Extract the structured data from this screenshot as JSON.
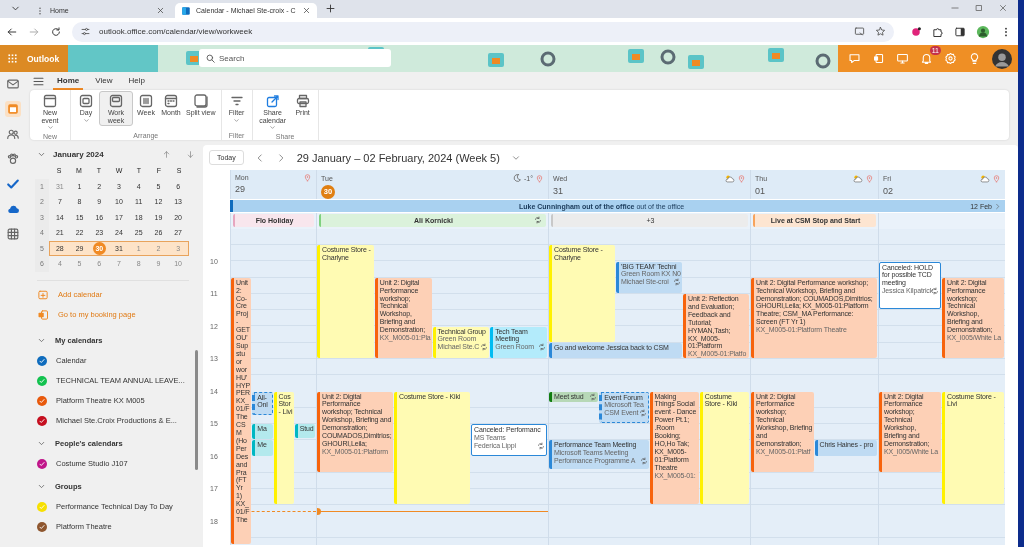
{
  "browser": {
    "tabs": [
      {
        "title": "Home",
        "selected": false
      },
      {
        "title": "Calendar - Michael Ste-croix - C",
        "selected": true
      }
    ],
    "url": "outlook.office.com/calendar/view/workweek"
  },
  "header": {
    "app_name": "Outlook",
    "search": {
      "placeholder": "Search"
    },
    "notification_count": "11"
  },
  "rail": [
    {
      "selected": false
    },
    {
      "selected": true
    },
    {
      "selected": false
    },
    {
      "selected": false
    },
    {
      "selected": false
    },
    {
      "selected": false
    },
    {
      "selected": false
    }
  ],
  "ribbon": {
    "tabs": [
      {
        "label": "Home",
        "selected": true
      },
      {
        "label": "View",
        "selected": false
      },
      {
        "label": "Help",
        "selected": false
      }
    ],
    "groups": [
      {
        "label": "New",
        "buttons": [
          {
            "label": "New event",
            "dropdown": true,
            "selected": false
          }
        ]
      },
      {
        "label": "Arrange",
        "buttons": [
          {
            "label": "Day",
            "dropdown": true,
            "selected": false
          },
          {
            "label": "Work week",
            "dropdown": false,
            "selected": true
          },
          {
            "label": "Week",
            "dropdown": false,
            "selected": false
          },
          {
            "label": "Month",
            "dropdown": false,
            "selected": false
          },
          {
            "label": "Split view",
            "dropdown": false,
            "selected": false
          }
        ]
      },
      {
        "label": "Filter",
        "buttons": [
          {
            "label": "Filter",
            "dropdown": true,
            "selected": false
          }
        ]
      },
      {
        "label": "Share",
        "buttons": [
          {
            "label": "Share calendar",
            "dropdown": true,
            "selected": false
          },
          {
            "label": "Print",
            "dropdown": false,
            "selected": false
          }
        ]
      }
    ]
  },
  "mini_calendar": {
    "title": "January 2024",
    "weekdays": [
      "S",
      "M",
      "T",
      "W",
      "T",
      "F",
      "S"
    ],
    "weeks": [
      {
        "number": "1",
        "selected": false,
        "days": [
          {
            "day": "31",
            "other_month": true,
            "today": false
          },
          {
            "day": "1",
            "other_month": false,
            "today": false
          },
          {
            "day": "2",
            "other_month": false,
            "today": false
          },
          {
            "day": "3",
            "other_month": false,
            "today": false
          },
          {
            "day": "4",
            "other_month": false,
            "today": false
          },
          {
            "day": "5",
            "other_month": false,
            "today": false
          },
          {
            "day": "6",
            "other_month": false,
            "today": false
          }
        ]
      },
      {
        "number": "2",
        "selected": false,
        "days": [
          {
            "day": "7",
            "other_month": false,
            "today": false
          },
          {
            "day": "8",
            "other_month": false,
            "today": false
          },
          {
            "day": "9",
            "other_month": false,
            "today": false
          },
          {
            "day": "10",
            "other_month": false,
            "today": false
          },
          {
            "day": "11",
            "other_month": false,
            "today": false
          },
          {
            "day": "12",
            "other_month": false,
            "today": false
          },
          {
            "day": "13",
            "other_month": false,
            "today": false
          }
        ]
      },
      {
        "number": "3",
        "selected": false,
        "days": [
          {
            "day": "14",
            "other_month": false,
            "today": false
          },
          {
            "day": "15",
            "other_month": false,
            "today": false
          },
          {
            "day": "16",
            "other_month": false,
            "today": false
          },
          {
            "day": "17",
            "other_month": false,
            "today": false
          },
          {
            "day": "18",
            "other_month": false,
            "today": false
          },
          {
            "day": "19",
            "other_month": false,
            "today": false
          },
          {
            "day": "20",
            "other_month": false,
            "today": false
          }
        ]
      },
      {
        "number": "4",
        "selected": false,
        "days": [
          {
            "day": "21",
            "other_month": false,
            "today": false
          },
          {
            "day": "22",
            "other_month": false,
            "today": false
          },
          {
            "day": "23",
            "other_month": false,
            "today": false
          },
          {
            "day": "24",
            "other_month": false,
            "today": false
          },
          {
            "day": "25",
            "other_month": false,
            "today": false
          },
          {
            "day": "26",
            "other_month": false,
            "today": false
          },
          {
            "day": "27",
            "other_month": false,
            "today": false
          }
        ]
      },
      {
        "number": "5",
        "selected": true,
        "days": [
          {
            "day": "28",
            "other_month": false,
            "today": false
          },
          {
            "day": "29",
            "other_month": false,
            "today": false
          },
          {
            "day": "30",
            "other_month": false,
            "today": true
          },
          {
            "day": "31",
            "other_month": false,
            "today": false
          },
          {
            "day": "1",
            "other_month": true,
            "today": false
          },
          {
            "day": "2",
            "other_month": true,
            "today": false
          },
          {
            "day": "3",
            "other_month": true,
            "today": false
          }
        ]
      },
      {
        "number": "6",
        "selected": false,
        "days": [
          {
            "day": "4",
            "other_month": true,
            "today": false
          },
          {
            "day": "5",
            "other_month": true,
            "today": false
          },
          {
            "day": "6",
            "other_month": true,
            "today": false
          },
          {
            "day": "7",
            "other_month": true,
            "today": false
          },
          {
            "day": "8",
            "other_month": true,
            "today": false
          },
          {
            "day": "9",
            "other_month": true,
            "today": false
          },
          {
            "day": "10",
            "other_month": true,
            "today": false
          }
        ]
      }
    ]
  },
  "links": [
    "Add calendar",
    "Go to my booking page"
  ],
  "calendar_groups": [
    {
      "title": "My calendars",
      "expanded": true,
      "items": [
        {
          "name": "Calendar",
          "color": "#0f6cbd",
          "checked": true
        },
        {
          "name": "TECHNICAL TEAM ANNUAL LEAVE...",
          "color": "#13c24f",
          "checked": true
        },
        {
          "name": "Platform Theatre KX M005",
          "color": "#e8590c",
          "checked": true
        },
        {
          "name": "Michael Ste.Croix Productions & E...",
          "color": "#c50f1f",
          "checked": true
        }
      ]
    },
    {
      "title": "People's calendars",
      "expanded": true,
      "items": [
        {
          "name": "Costume Studio J107",
          "color": "#c0168a",
          "checked": true
        }
      ]
    },
    {
      "title": "Groups",
      "expanded": true,
      "items": [
        {
          "name": "Performance Technical Day To Day",
          "color": "#f7e000",
          "checked": true
        },
        {
          "name": "Platform Theatre",
          "color": "#8e562e",
          "checked": true
        }
      ]
    }
  ],
  "calendar": {
    "today_button": "Today",
    "range_title": "29 January – 02 February, 2024 (Week 5)",
    "banner": {
      "text": "**Luke Cunningham out of the office** out of the office",
      "continues": "12 Feb"
    },
    "hours": [
      "10",
      "11",
      "12",
      "13",
      "14",
      "15",
      "16",
      "17",
      "18"
    ],
    "days": [
      {
        "name": "Mon",
        "date": "29",
        "today": false,
        "all_day": {
          "text": "Flo Holiday",
          "color": "#e7a6bf",
          "recurring": false,
          "kind": "event"
        },
        "events": [
          {
            "color": "#f7630c",
            "title": "Unit 2: Co- Cre Proj - GET OU' Sup stu or wor HU' HYP PER KX_ 01/F The CSM (Ho Per Des and Pra (FT Yr 1) KX_ 01/F The",
            "recurring": false,
            "canceled": false,
            "tentative": false
          },
          {
            "color": "#2b88d8",
            "title": "All- Onl",
            "recurring": false,
            "canceled": false,
            "tentative": true
          },
          {
            "color": "#00b7c3",
            "title": "Ma",
            "recurring": false,
            "canceled": false,
            "tentative": false
          },
          {
            "color": "#00b7c3",
            "title": "Me",
            "recurring": false,
            "canceled": false,
            "tentative": false
          },
          {
            "color": "#fff100",
            "title": "Cos Stor - Livi",
            "recurring": false,
            "canceled": false,
            "tentative": false
          },
          {
            "color": "#00b7c3",
            "title": "Stud",
            "recurring": false,
            "canceled": false,
            "tentative": false
          }
        ]
      },
      {
        "name": "Tue",
        "date": "30",
        "today": true,
        "weather": {
          "kind": "night",
          "temperature": "-1°"
        },
        "all_day": {
          "text": "Ali Kornicki",
          "color": "#7fd17f",
          "recurring": true,
          "kind": "event"
        },
        "events": [
          {
            "color": "#fff100",
            "title": "Costume Store - Charlyne",
            "recurring": false,
            "canceled": false,
            "tentative": false
          },
          {
            "color": "#f7630c",
            "title": "Unit 2: Digital Performance workshop; Technical Workshop, Briefing and Demonstration;",
            "details": [
              "KX_M005-01:Pla"
            ],
            "recurring": false,
            "canceled": false,
            "tentative": false
          },
          {
            "color": "#fff100",
            "title": "Technical Group",
            "details": [
              "Green Room",
              "Michael Ste.C"
            ],
            "recurring": true,
            "canceled": false,
            "tentative": false
          },
          {
            "color": "#00bcf2",
            "title": "Tech Team Meeting",
            "details": [
              "Green Room"
            ],
            "recurring": true,
            "canceled": false,
            "tentative": false
          },
          {
            "color": "#f7630c",
            "title": "Unit 2: Digital Performance workshop; Technical Workshop, Briefing and Demonstration; COUMADOS,Dimitrios; GHOURI,Leila;",
            "details": [
              "KX_M005-01:Platform"
            ],
            "recurring": false,
            "canceled": false,
            "tentative": false
          },
          {
            "color": "#fff100",
            "title": "Costume Store - Kiki",
            "recurring": false,
            "canceled": false,
            "tentative": false
          },
          {
            "color": "#2b88d8",
            "title": "Canceled: Performanc",
            "details": [
              "MS Teams",
              "Federica Lippi"
            ],
            "recurring": true,
            "canceled": true,
            "tentative": false
          }
        ]
      },
      {
        "name": "Wed",
        "date": "31",
        "today": false,
        "weather": {
          "kind": "cloudy"
        },
        "all_day": {
          "text": "+3",
          "color": "#c8c8c8",
          "recurring": false,
          "kind": "more"
        },
        "events": [
          {
            "color": "#fff100",
            "title": "Costume Store - Charlyne",
            "recurring": false,
            "canceled": false,
            "tentative": false
          },
          {
            "color": "#2b88d8",
            "title": "'BIG TEAM' Techni",
            "details": [
              "Green Room KX N0",
              "Michael Ste-croi"
            ],
            "recurring": true,
            "canceled": false,
            "tentative": false
          },
          {
            "color": "#2b88d8",
            "title": "Go and welcome Jessica back to CSM",
            "recurring": false,
            "canceled": false,
            "tentative": false
          },
          {
            "color": "#f7630c",
            "title": "Unit 2: Reflection and Evaluation; Feedback and Tutorial; HYMAN,Tash; KX_M005- 01:Platform",
            "details": [
              "KX_M005-01:Platfo"
            ],
            "recurring": false,
            "canceled": false,
            "tentative": false
          },
          {
            "color": "#107c10",
            "title": "Meet stud",
            "recurring": true,
            "canceled": false,
            "tentative": false
          },
          {
            "color": "#2b88d8",
            "title": "Event Forum",
            "details": [
              "Microsoft Tea",
              "CSM Event"
            ],
            "recurring": true,
            "canceled": false,
            "tentative": true
          },
          {
            "color": "#2b88d8",
            "title": "Performance Team Meeting",
            "details": [
              "Microsoft Teams Meeting",
              "Performance Programme A"
            ],
            "recurring": true,
            "canceled": false,
            "tentative": false
          },
          {
            "color": "#f7630c",
            "title": "Making Things Social event - Dance Power Pt.1; .Room Booking; HO,Ho Tak; KX_M005- 01:Platform Theatre",
            "details": [
              "KX_M005-01:"
            ],
            "recurring": false,
            "canceled": false,
            "tentative": false
          },
          {
            "color": "#fff100",
            "title": "Costume Store - Kiki",
            "recurring": false,
            "canceled": false,
            "tentative": false
          }
        ]
      },
      {
        "name": "Thu",
        "date": "01",
        "today": false,
        "weather": {
          "kind": "cloudy"
        },
        "all_day": {
          "text": "Live at CSM Stop and Start",
          "color": "#f7a35c",
          "recurring": false,
          "kind": "event"
        },
        "events": [
          {
            "color": "#f7630c",
            "title": "Unit 2: Digital Performance workshop; Technical Workshop, Briefing and Demonstration; COUMADOS,Dimitrios; GHOURI,Leila; KX_M005-01:Platform Theatre; CSM_MA Performance: Screen (FT Yr 1)",
            "details": [
              "KX_M005-01:Platform Theatre"
            ],
            "recurring": false,
            "canceled": false,
            "tentative": false
          },
          {
            "color": "#f7630c",
            "title": "Unit 2: Digital Performance workshop; Technical Workshop, Briefing and Demonstration;",
            "details": [
              "KX_M005-01:Platf"
            ],
            "recurring": false,
            "canceled": false,
            "tentative": false
          },
          {
            "color": "#2b88d8",
            "title": "Chris Haines - pro",
            "recurring": false,
            "canceled": false,
            "tentative": false
          }
        ]
      },
      {
        "name": "Fri",
        "date": "02",
        "today": false,
        "weather": {
          "kind": "cloudy"
        },
        "events": [
          {
            "color": "#2b88d8",
            "title": "Canceled: HOLD for possible TCD meeting",
            "details": [
              "Jessica Kilpatrick"
            ],
            "recurring": true,
            "canceled": true,
            "tentative": false
          },
          {
            "color": "#f7630c",
            "title": "Unit 2: Digital Performance workshop; Technical Workshop, Briefing and Demonstration;",
            "details": [
              "KX_I005/White La"
            ],
            "recurring": false,
            "canceled": false,
            "tentative": false
          },
          {
            "color": "#f7630c",
            "title": "Unit 2: Digital Performance workshop; Technical Workshop, Briefing and Demonstration;",
            "details": [
              "KX_I005/White La"
            ],
            "recurring": false,
            "canceled": false,
            "tentative": false
          },
          {
            "color": "#fff100",
            "title": "Costume Store - Livi",
            "recurring": false,
            "canceled": false,
            "tentative": false
          }
        ]
      }
    ]
  }
}
